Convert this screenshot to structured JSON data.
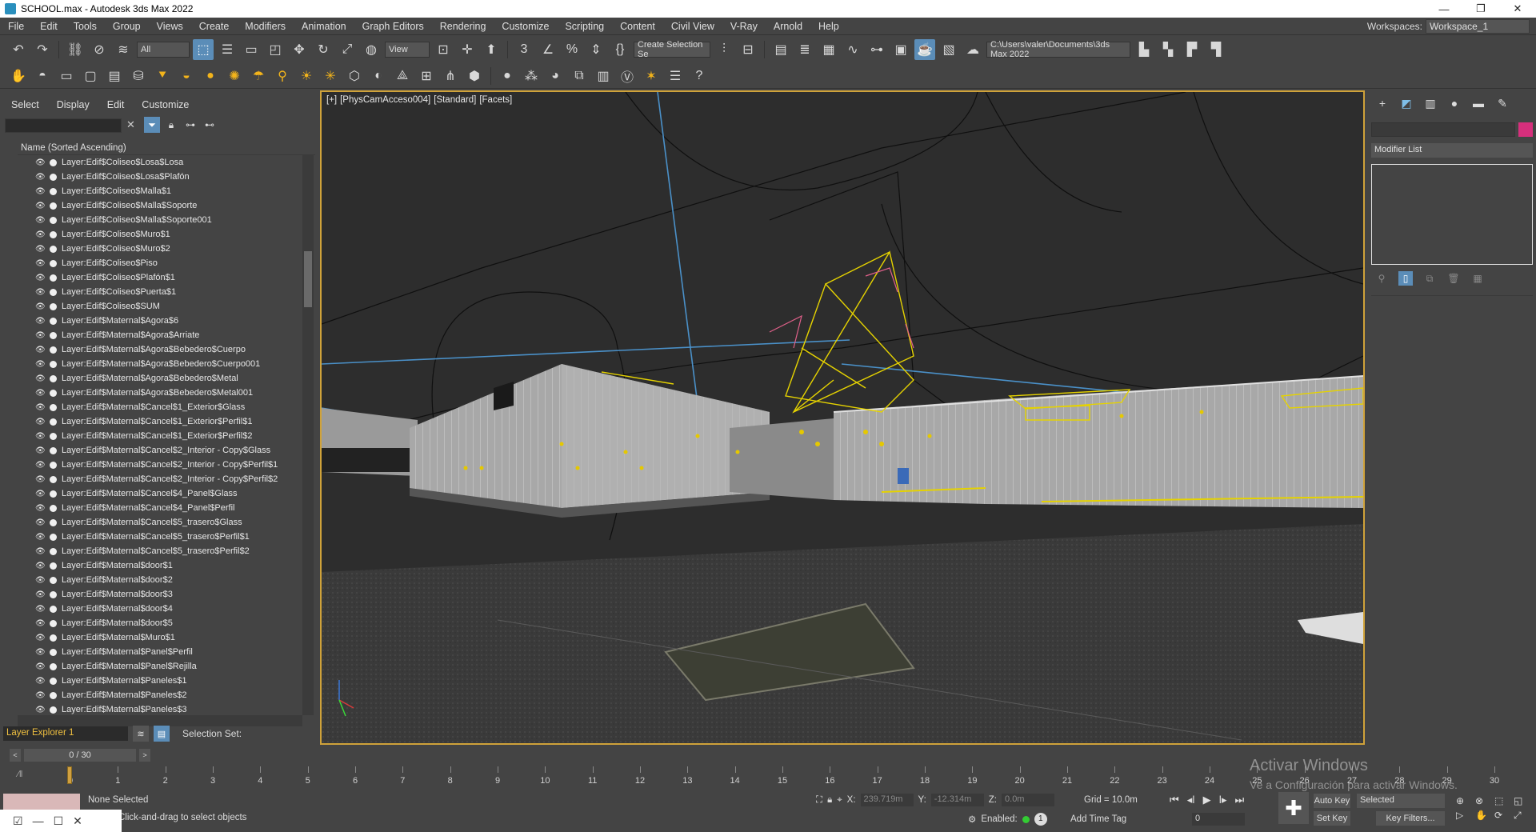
{
  "window": {
    "title": "SCHOOL.max - Autodesk 3ds Max 2022",
    "minimize": "—",
    "restore": "❐",
    "close": "✕"
  },
  "menu": {
    "items": [
      "File",
      "Edit",
      "Tools",
      "Group",
      "Views",
      "Create",
      "Modifiers",
      "Animation",
      "Graph Editors",
      "Rendering",
      "Customize",
      "Scripting",
      "Content",
      "Civil View",
      "V-Ray",
      "Arnold",
      "Help"
    ],
    "workspaces_label": "Workspaces:",
    "workspace_value": "Workspace_1"
  },
  "toolbar1": {
    "filter_select": "All",
    "refcoord_select": "View",
    "selection_set": "Create Selection Se",
    "project_path": "C:\\Users\\valer\\Documents\\3ds Max 2022"
  },
  "explorer": {
    "tabs": [
      "Select",
      "Display",
      "Edit",
      "Customize"
    ],
    "column_header": "Name (Sorted Ascending)",
    "rows": [
      "Layer:Edif$Coliseo$Losa$Losa",
      "Layer:Edif$Coliseo$Losa$Plafón",
      "Layer:Edif$Coliseo$Malla$1",
      "Layer:Edif$Coliseo$Malla$Soporte",
      "Layer:Edif$Coliseo$Malla$Soporte001",
      "Layer:Edif$Coliseo$Muro$1",
      "Layer:Edif$Coliseo$Muro$2",
      "Layer:Edif$Coliseo$Piso",
      "Layer:Edif$Coliseo$Plafón$1",
      "Layer:Edif$Coliseo$Puerta$1",
      "Layer:Edif$Coliseo$SUM",
      "Layer:Edif$Maternal$Agora$6",
      "Layer:Edif$Maternal$Agora$Arriate",
      "Layer:Edif$Maternal$Agora$Bebedero$Cuerpo",
      "Layer:Edif$Maternal$Agora$Bebedero$Cuerpo001",
      "Layer:Edif$Maternal$Agora$Bebedero$Metal",
      "Layer:Edif$Maternal$Agora$Bebedero$Metal001",
      "Layer:Edif$Maternal$Cancel$1_Exterior$Glass",
      "Layer:Edif$Maternal$Cancel$1_Exterior$Perfil$1",
      "Layer:Edif$Maternal$Cancel$1_Exterior$Perfil$2",
      "Layer:Edif$Maternal$Cancel$2_Interior - Copy$Glass",
      "Layer:Edif$Maternal$Cancel$2_Interior - Copy$Perfil$1",
      "Layer:Edif$Maternal$Cancel$2_Interior - Copy$Perfil$2",
      "Layer:Edif$Maternal$Cancel$4_Panel$Glass",
      "Layer:Edif$Maternal$Cancel$4_Panel$Perfil",
      "Layer:Edif$Maternal$Cancel$5_trasero$Glass",
      "Layer:Edif$Maternal$Cancel$5_trasero$Perfil$1",
      "Layer:Edif$Maternal$Cancel$5_trasero$Perfil$2",
      "Layer:Edif$Maternal$door$1",
      "Layer:Edif$Maternal$door$2",
      "Layer:Edif$Maternal$door$3",
      "Layer:Edif$Maternal$door$4",
      "Layer:Edif$Maternal$door$5",
      "Layer:Edif$Maternal$Muro$1",
      "Layer:Edif$Maternal$Panel$Perfil",
      "Layer:Edif$Maternal$Panel$Rejilla",
      "Layer:Edif$Maternal$Paneles$1",
      "Layer:Edif$Maternal$Paneles$2",
      "Layer:Edif$Maternal$Paneles$3"
    ],
    "explorer_name": "Layer Explorer 1",
    "selection_set_label": "Selection Set:",
    "frame_counter": "0 / 30"
  },
  "viewport": {
    "labels": [
      "[+]",
      "[PhysCamAcceso004]",
      "[Standard]",
      "[Facets]"
    ]
  },
  "command_panel": {
    "modifier_list": "Modifier List"
  },
  "timeline": {
    "ticks": [
      "0",
      "1",
      "2",
      "3",
      "4",
      "5",
      "6",
      "7",
      "8",
      "9",
      "10",
      "11",
      "12",
      "13",
      "14",
      "15",
      "16",
      "17",
      "18",
      "19",
      "20",
      "21",
      "22",
      "23",
      "24",
      "25",
      "26",
      "27",
      "28",
      "29",
      "30"
    ]
  },
  "status": {
    "selection": "None Selected",
    "prompt": "Click-and-drag to select objects",
    "x_label": "X:",
    "x_value": "239.719m",
    "y_label": "Y:",
    "y_value": "-12.314m",
    "z_label": "Z:",
    "z_value": "0.0m",
    "grid": "Grid = 10.0m",
    "enabled_label": "Enabled:",
    "enabled_count": "1",
    "add_time_tag": "Add Time Tag",
    "frame_value": "0",
    "auto_key": "Auto Key",
    "set_key": "Set Key",
    "key_mode": "Selected",
    "key_filters": "Key Filters..."
  },
  "watermark": {
    "line1": "Activar Windows",
    "line2": "Ve a Configuración para activar Windows."
  }
}
